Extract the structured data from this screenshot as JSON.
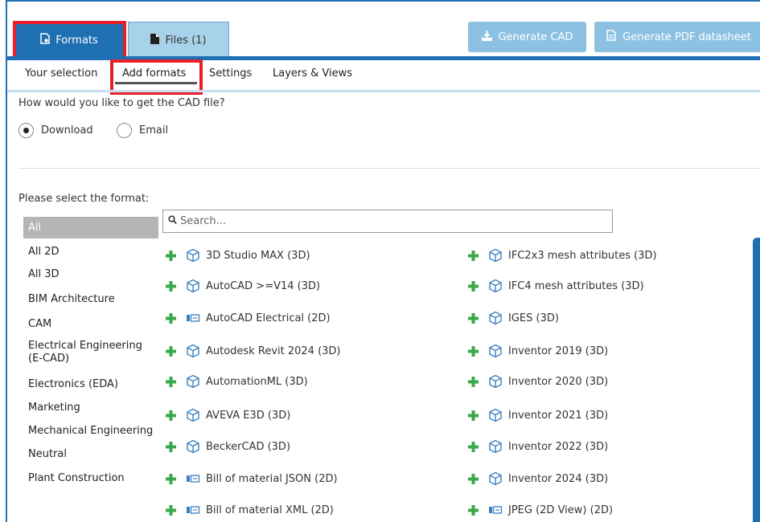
{
  "tabs": {
    "formats": "Formats",
    "files": "Files (1)"
  },
  "actions": {
    "generate_cad": "Generate CAD",
    "generate_pdf": "Generate PDF datasheet"
  },
  "subtabs": [
    "Your selection",
    "Add formats",
    "Settings",
    "Layers & Views"
  ],
  "question": "How would you like to get the CAD file?",
  "delivery": {
    "download": "Download",
    "email": "Email",
    "selected": "Download"
  },
  "select_label": "Please select the format:",
  "search": {
    "placeholder": "Search...",
    "value": ""
  },
  "categories": [
    "All",
    "All 2D",
    "All 3D",
    "BIM Architecture",
    "CAM",
    "Electrical Engineering (E-CAD)",
    "Electronics (EDA)",
    "Marketing",
    "Mechanical Engineering",
    "Neutral",
    "Plant Construction"
  ],
  "formats_col1": [
    {
      "label": "3D Studio MAX (3D)",
      "icon": "cube-icon"
    },
    {
      "label": "AutoCAD >=V14 (3D)",
      "icon": "cube-icon"
    },
    {
      "label": "AutoCAD Electrical (2D)",
      "icon": "drawing-2d-icon"
    },
    {
      "label": "Autodesk Revit 2024 (3D)",
      "icon": "cube-icon"
    },
    {
      "label": "AutomationML (3D)",
      "icon": "cube-icon"
    },
    {
      "label": "AVEVA E3D (3D)",
      "icon": "cube-icon"
    },
    {
      "label": "BeckerCAD (3D)",
      "icon": "cube-icon"
    },
    {
      "label": "Bill of material JSON (2D)",
      "icon": "drawing-2d-icon"
    },
    {
      "label": "Bill of material XML (2D)",
      "icon": "drawing-2d-icon"
    }
  ],
  "formats_col2": [
    {
      "label": "IFC2x3 mesh attributes (3D)",
      "icon": "cube-icon"
    },
    {
      "label": "IFC4 mesh attributes (3D)",
      "icon": "cube-icon"
    },
    {
      "label": "IGES (3D)",
      "icon": "cube-icon"
    },
    {
      "label": "Inventor 2019 (3D)",
      "icon": "cube-icon"
    },
    {
      "label": "Inventor 2020 (3D)",
      "icon": "cube-icon"
    },
    {
      "label": "Inventor 2021 (3D)",
      "icon": "cube-icon"
    },
    {
      "label": "Inventor 2022 (3D)",
      "icon": "cube-icon"
    },
    {
      "label": "Inventor 2024 (3D)",
      "icon": "cube-icon"
    },
    {
      "label": "JPEG (2D View) (2D)",
      "icon": "drawing-2d-icon"
    }
  ],
  "colors": {
    "primary": "#1f6fb3",
    "tab_inactive": "#a8d2ea",
    "button_disabled": "#8dc1e3",
    "add": "#3aa84a",
    "highlight": "#e8202a",
    "category_selected": "#b5b5b5"
  }
}
